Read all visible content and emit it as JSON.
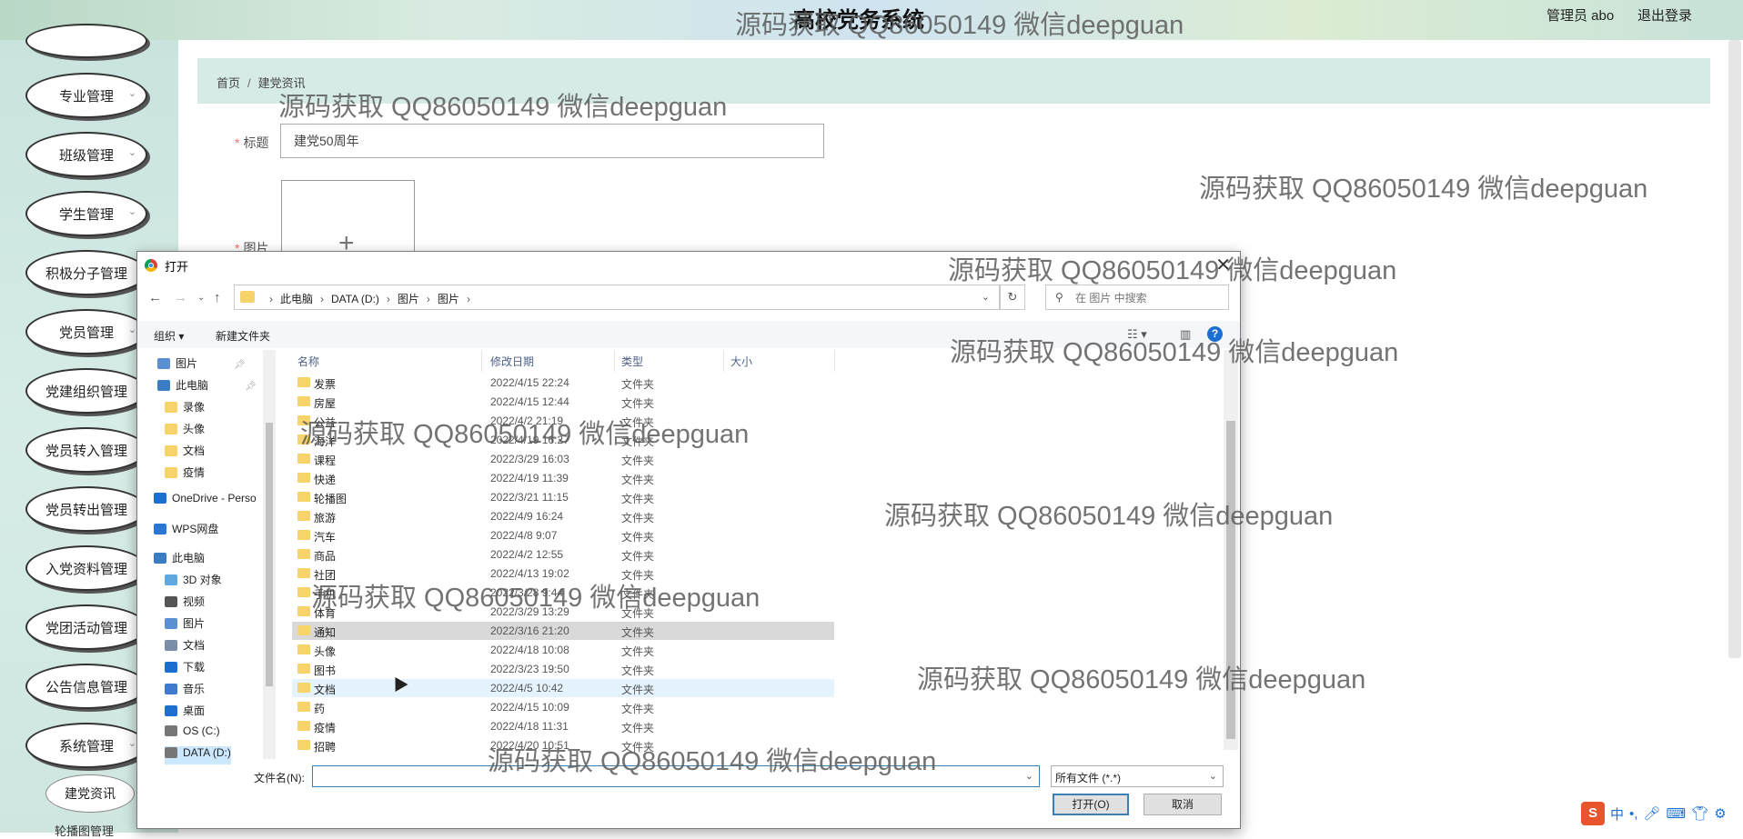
{
  "app": {
    "title": "高校党务系统",
    "user_label": "管理员 abo",
    "logout_label": "退出登录"
  },
  "sidebar": {
    "items": [
      {
        "label": "专业管理"
      },
      {
        "label": "班级管理"
      },
      {
        "label": "学生管理"
      },
      {
        "label": "积极分子管理"
      },
      {
        "label": "党员管理"
      },
      {
        "label": "党建组织管理"
      },
      {
        "label": "党员转入管理"
      },
      {
        "label": "党员转出管理"
      },
      {
        "label": "入党资料管理"
      },
      {
        "label": "党团活动管理"
      },
      {
        "label": "公告信息管理"
      },
      {
        "label": "系统管理"
      }
    ],
    "submenu_active": "建党资讯",
    "submenu_next": "轮播图管理"
  },
  "main": {
    "breadcrumb": {
      "home": "首页",
      "sep": "/",
      "current": "建党资讯"
    },
    "form": {
      "title_label": "标题",
      "title_value": "建党50周年",
      "image_label": "图片"
    }
  },
  "dialog": {
    "title": "打开",
    "path": [
      "此电脑",
      "DATA (D:)",
      "图片",
      "图片"
    ],
    "search_placeholder": "在 图片 中搜索",
    "toolbar": {
      "organize": "组织 ▾",
      "new_folder": "新建文件夹"
    },
    "nav": [
      {
        "label": "图片",
        "icon": "pictures-icon",
        "pinned": true
      },
      {
        "label": "此电脑",
        "icon": "computer-icon",
        "pinned": true
      },
      {
        "label": "录像",
        "icon": "folder-icon"
      },
      {
        "label": "头像",
        "icon": "folder-icon"
      },
      {
        "label": "文档",
        "icon": "folder-icon"
      },
      {
        "label": "疫情",
        "icon": "folder-icon"
      },
      {
        "label": "OneDrive - Perso",
        "icon": "onedrive-icon"
      },
      {
        "label": "WPS网盘",
        "icon": "wps-cloud-icon"
      },
      {
        "label": "此电脑",
        "icon": "computer-icon"
      },
      {
        "label": "3D 对象",
        "icon": "3d-objects-icon"
      },
      {
        "label": "视频",
        "icon": "video-icon"
      },
      {
        "label": "图片",
        "icon": "pictures-icon"
      },
      {
        "label": "文档",
        "icon": "documents-icon"
      },
      {
        "label": "下载",
        "icon": "download-icon"
      },
      {
        "label": "音乐",
        "icon": "music-icon"
      },
      {
        "label": "桌面",
        "icon": "desktop-icon"
      },
      {
        "label": "OS (C:)",
        "icon": "drive-icon"
      },
      {
        "label": "DATA (D:)",
        "icon": "drive-icon"
      }
    ],
    "columns": {
      "name": "名称",
      "date": "修改日期",
      "type": "类型",
      "size": "大小"
    },
    "files": [
      {
        "name": "发票",
        "date": "2022/4/15 22:24",
        "type": "文件夹"
      },
      {
        "name": "房屋",
        "date": "2022/4/15 12:44",
        "type": "文件夹"
      },
      {
        "name": "公益",
        "date": "2022/4/2 21:19",
        "type": "文件夹"
      },
      {
        "name": "海洋",
        "date": "2022/4/19 16:27",
        "type": "文件夹"
      },
      {
        "name": "课程",
        "date": "2022/3/29 16:03",
        "type": "文件夹"
      },
      {
        "name": "快递",
        "date": "2022/4/19 11:39",
        "type": "文件夹"
      },
      {
        "name": "轮播图",
        "date": "2022/3/21 11:15",
        "type": "文件夹"
      },
      {
        "name": "旅游",
        "date": "2022/4/9 16:24",
        "type": "文件夹"
      },
      {
        "name": "汽车",
        "date": "2022/4/8 9:07",
        "type": "文件夹"
      },
      {
        "name": "商品",
        "date": "2022/4/2 12:55",
        "type": "文件夹"
      },
      {
        "name": "社团",
        "date": "2022/4/13 19:02",
        "type": "文件夹"
      },
      {
        "name": "手机",
        "date": "2022/3/28 9:44",
        "type": "文件夹"
      },
      {
        "name": "体育",
        "date": "2022/3/29 13:29",
        "type": "文件夹"
      },
      {
        "name": "通知",
        "date": "2022/3/16 21:20",
        "type": "文件夹"
      },
      {
        "name": "头像",
        "date": "2022/4/18 10:08",
        "type": "文件夹"
      },
      {
        "name": "图书",
        "date": "2022/3/23 19:50",
        "type": "文件夹"
      },
      {
        "name": "文档",
        "date": "2022/4/5 10:42",
        "type": "文件夹"
      },
      {
        "name": "药",
        "date": "2022/4/15 10:09",
        "type": "文件夹"
      },
      {
        "name": "疫情",
        "date": "2022/4/18 11:31",
        "type": "文件夹"
      },
      {
        "name": "招聘",
        "date": "2022/4/20 10:51",
        "type": "文件夹"
      }
    ],
    "filename_label": "文件名(N):",
    "filename_value": "",
    "filetype_value": "所有文件 (*.*)",
    "open_label": "打开(O)",
    "cancel_label": "取消"
  },
  "watermark": "源码获取 QQ86050149 微信deepguan",
  "ime": {
    "label": "中"
  }
}
